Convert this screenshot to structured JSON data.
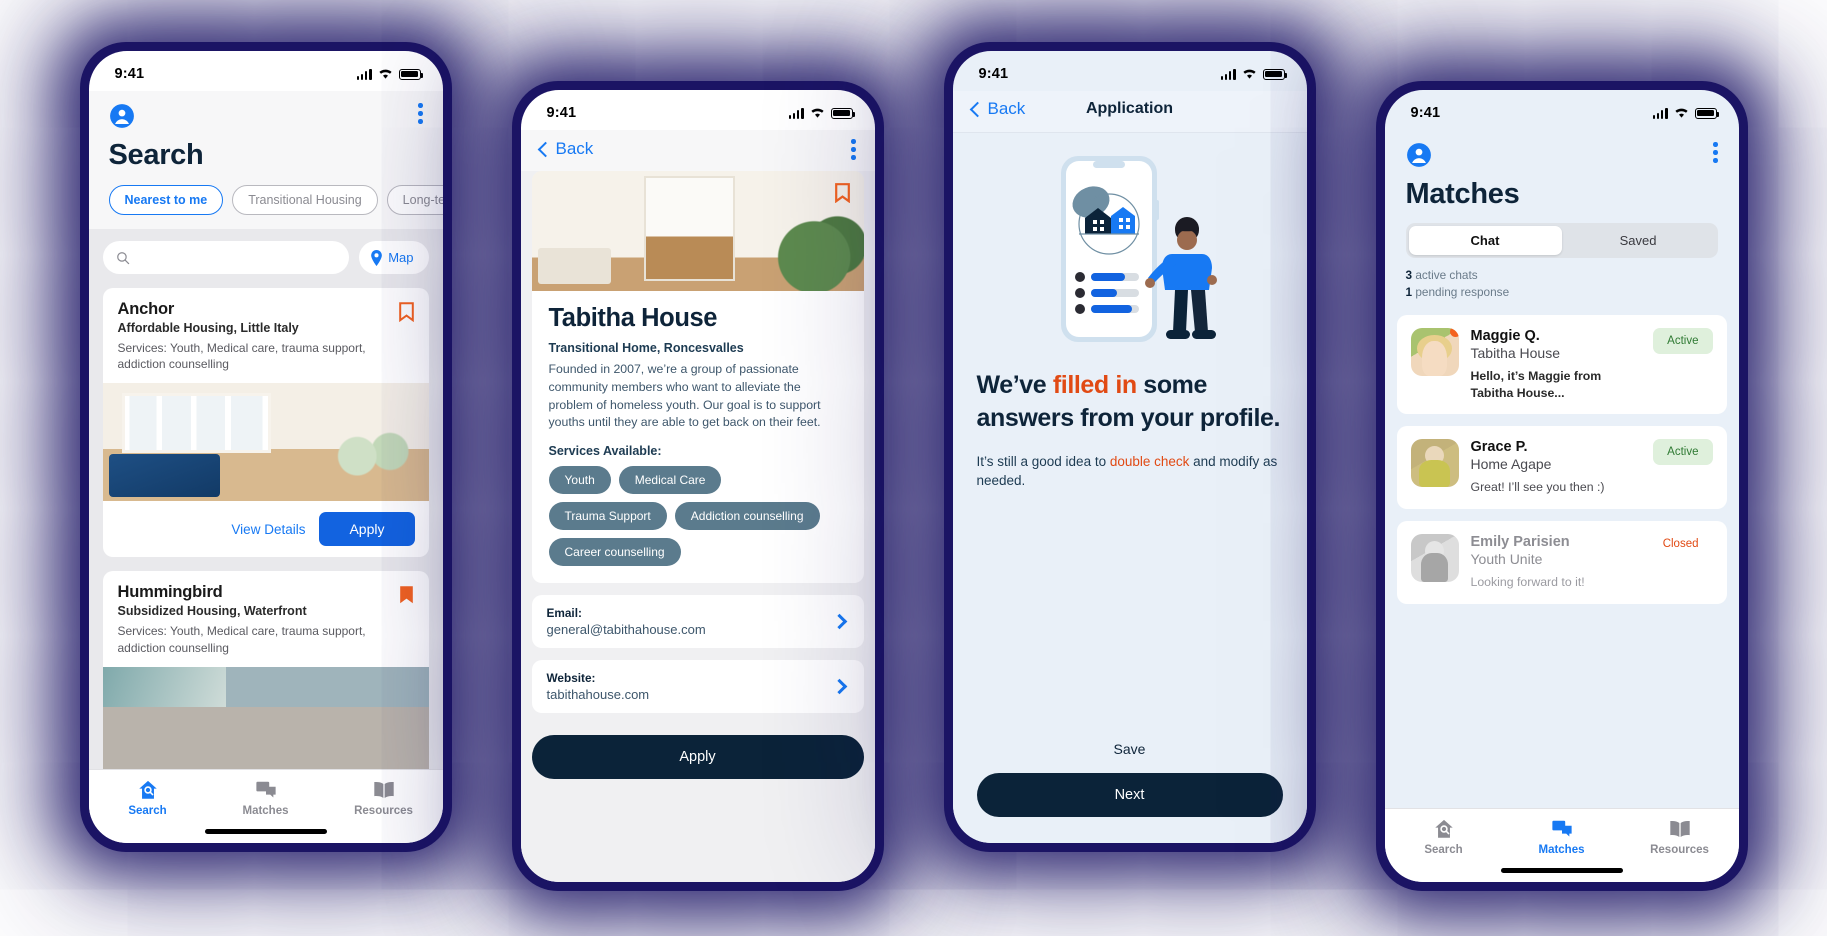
{
  "theme": {
    "accent_blue": "#1779f3",
    "primary_blue": "#1263e0",
    "dark_navy": "#0b2339",
    "orange": "#e14a14",
    "bookmark_orange": "#f4621f",
    "teal_tag": "#5b7b8d",
    "green_badge_bg": "#dff0dc",
    "green_badge_text": "#2f7a33",
    "phone_frame": "#1b1464"
  },
  "status_bar": {
    "time": "9:41",
    "signal": "cellular-bars-icon",
    "wifi": "wifi-icon",
    "battery": "battery-full-icon"
  },
  "tab_bar": {
    "items": [
      {
        "label": "Search",
        "icon": "search-home-icon"
      },
      {
        "label": "Matches",
        "icon": "chat-bubbles-icon"
      },
      {
        "label": "Resources",
        "icon": "open-book-icon"
      }
    ]
  },
  "search_screen": {
    "profile_icon": "account-circle-icon",
    "menu_icon": "overflow-menu-icon",
    "title": "Search",
    "filters": [
      {
        "label": "Nearest to me",
        "selected": true
      },
      {
        "label": "Transitional Housing",
        "selected": false
      },
      {
        "label": "Long-term Housing",
        "selected": false
      }
    ],
    "search_input": {
      "value": "",
      "placeholder": "",
      "icon": "search-icon"
    },
    "map_button": {
      "label": "Map",
      "icon": "map-pin-icon"
    },
    "active_tab": "Search",
    "listings": [
      {
        "name": "Anchor",
        "subtitle": "Affordable Housing, Little Italy",
        "services": "Services: Youth, Medical care, trauma support, addiction counselling",
        "bookmarked": false,
        "photo": "living-room-photo",
        "view_details_label": "View Details",
        "apply_label": "Apply"
      },
      {
        "name": "Hummingbird",
        "subtitle": "Subsidized Housing, Waterfront",
        "services": "Services: Youth, Medical care, trauma support, addiction counselling",
        "bookmarked": true,
        "photo": "stone-building-photo"
      }
    ]
  },
  "detail_screen": {
    "back_label": "Back",
    "menu_icon": "overflow-menu-icon",
    "hero_photo": "kitchen-photo",
    "bookmarked": true,
    "title": "Tabitha House",
    "subtitle": "Transitional Home, Roncesvalles",
    "description": "Founded in 2007, we’re a group of passionate community members who want to alleviate the problem of homeless youth. Our goal is to support youths until they are able to get back on their feet.",
    "services_label": "Services Available:",
    "tags": [
      "Youth",
      "Medical Care",
      "Trauma Support",
      "Addiction counselling",
      "Career counselling"
    ],
    "contact_rows": [
      {
        "label": "Email:",
        "value": "general@tabithahouse.com",
        "chevron": "chevron-right-icon"
      },
      {
        "label": "Website:",
        "value": "tabithahouse.com",
        "chevron": "chevron-right-icon"
      }
    ],
    "apply_label": "Apply"
  },
  "application_screen": {
    "back_label": "Back",
    "title": "Application",
    "illustration": "phone-with-house-and-person-illustration",
    "heading_part1": "We’ve ",
    "heading_highlight": "filled in",
    "heading_part2": " some answers from your profile.",
    "note_part1": "It’s still a good idea to ",
    "note_highlight": "double check",
    "note_part2": " and modify as needed.",
    "save_label": "Save",
    "next_label": "Next"
  },
  "matches_screen": {
    "profile_icon": "account-circle-icon",
    "menu_icon": "overflow-menu-icon",
    "title": "Matches",
    "segments": [
      {
        "label": "Chat",
        "selected": true
      },
      {
        "label": "Saved",
        "selected": false
      }
    ],
    "counts": {
      "active_number": "3",
      "active_text": " active chats",
      "pending_number": "1",
      "pending_text": " pending response"
    },
    "active_tab": "Matches",
    "chats": [
      {
        "name": "Maggie Q.",
        "org": "Tabitha House",
        "message": "Hello, it’s Maggie from Tabitha House...",
        "status": "Active",
        "unread": true,
        "avatar": "maggie-avatar",
        "muted": false
      },
      {
        "name": "Grace P.",
        "org": "Home Agape",
        "message": "Great! I’ll see you then :)",
        "status": "Active",
        "unread": false,
        "avatar": "grace-avatar",
        "muted": false
      },
      {
        "name": "Emily Parisien",
        "org": "Youth Unite",
        "message": "Looking forward to it!",
        "status": "Closed",
        "unread": false,
        "avatar": "emily-avatar",
        "muted": true
      }
    ]
  }
}
